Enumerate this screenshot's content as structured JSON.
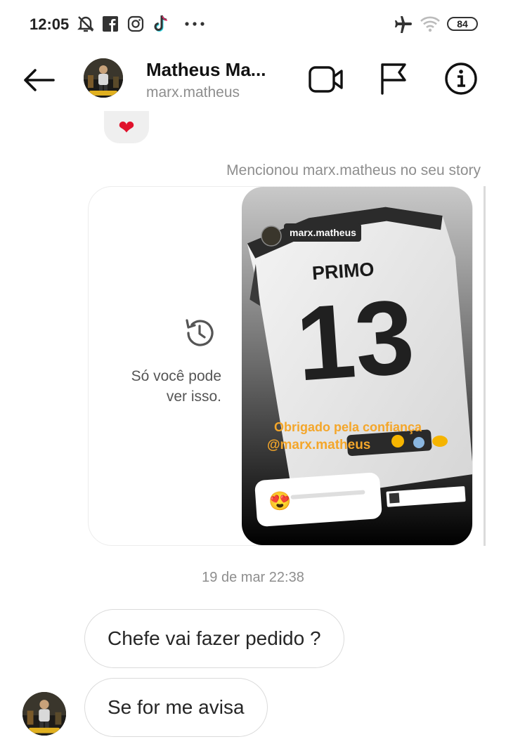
{
  "status_bar": {
    "time": "12:05",
    "battery": "84",
    "left_icons": [
      "muted-bell-icon",
      "facebook-icon",
      "instagram-icon",
      "tiktok-icon",
      "more-dots-icon"
    ],
    "right_icons": [
      "airplane-icon",
      "wifi-icon",
      "battery-icon"
    ]
  },
  "header": {
    "name": "Matheus Ma...",
    "username": "marx.matheus",
    "avatar_badge": "ESCADARIA",
    "actions": [
      "back-arrow-icon",
      "video-call-icon",
      "flag-icon",
      "info-icon"
    ]
  },
  "messages": {
    "reaction": "❤",
    "mention_note": "Mencionou marx.matheus no seu story",
    "story": {
      "private_notice": "Só você pode\nver isso.",
      "overlay_username": "marx.matheus",
      "jersey_name": "PRIMO",
      "jersey_number": "13",
      "caption_line1": "Obrigado pela confiança",
      "caption_line2": "@marx.matheus",
      "emoji_slider": "😍"
    },
    "date": "19 de mar 22:38",
    "bubble1": "Chefe vai fazer pedido ?",
    "bubble2": "Se for me avisa"
  },
  "colors": {
    "bubble_border": "#dbdbdb",
    "muted_text": "#8e8e8e",
    "heart": "#e0112b",
    "caption": "#f4a62a"
  }
}
